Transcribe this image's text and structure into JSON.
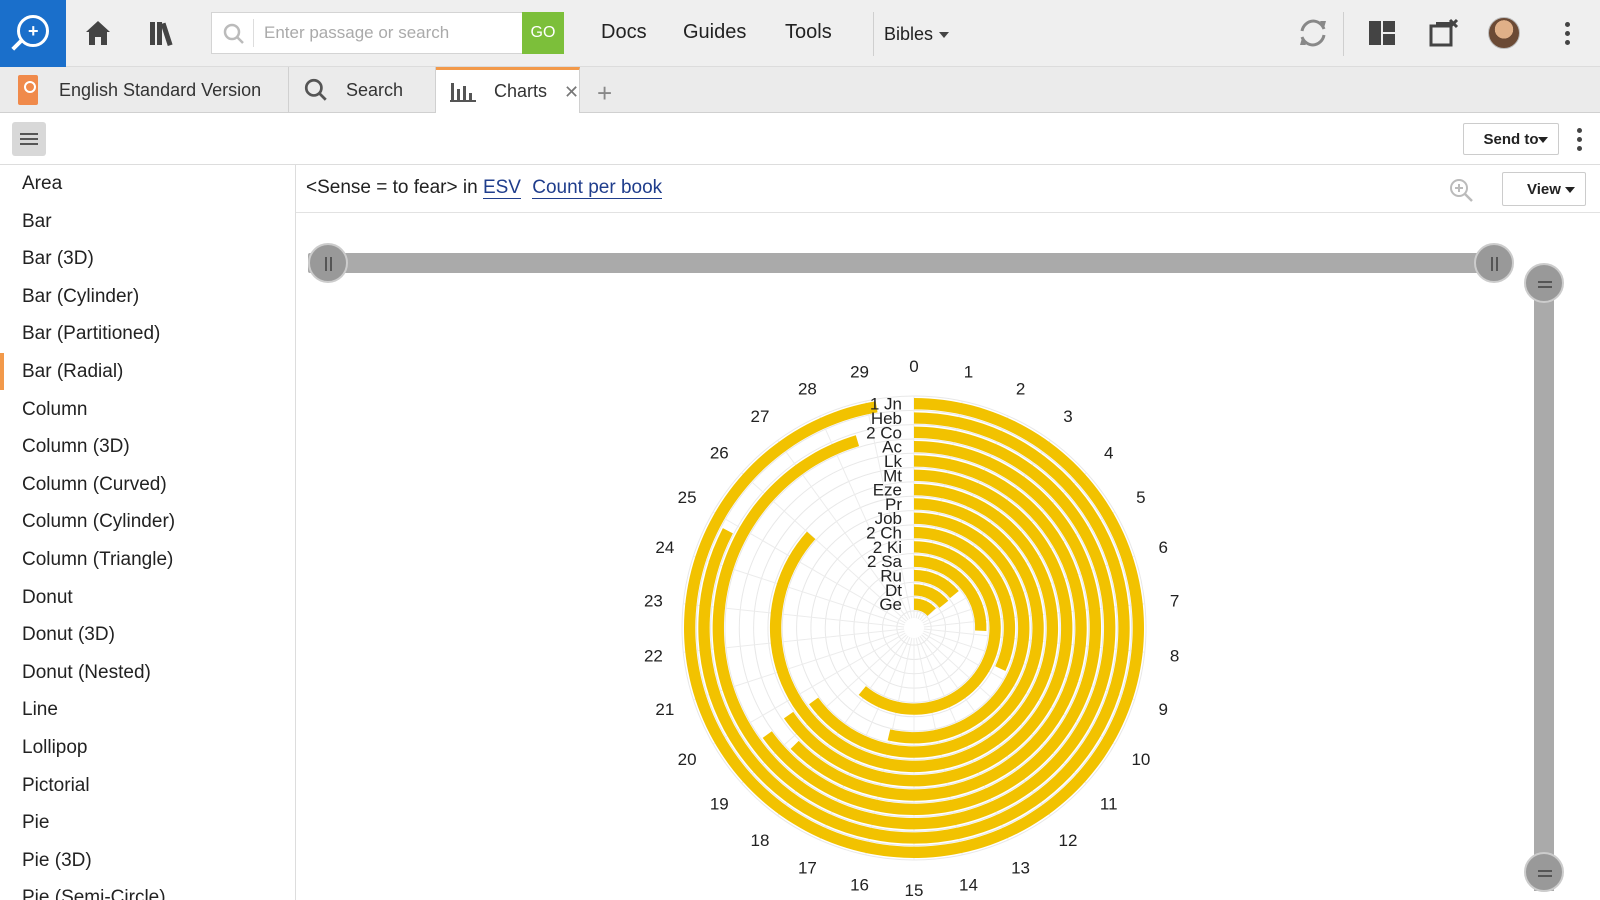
{
  "toolbar": {
    "search_placeholder": "Enter passage or search",
    "go_label": "GO",
    "nav": [
      "Docs",
      "Guides",
      "Tools"
    ],
    "bibles_label": "Bibles"
  },
  "tabs": [
    {
      "label": "English Standard Version"
    },
    {
      "label": "Search"
    },
    {
      "label": "Charts"
    }
  ],
  "panel": {
    "send_to_label": "Send to",
    "view_label": "View"
  },
  "sidebar": {
    "items": [
      "Area",
      "Bar",
      "Bar (3D)",
      "Bar (Cylinder)",
      "Bar (Partitioned)",
      "Bar (Radial)",
      "Column",
      "Column (3D)",
      "Column (Curved)",
      "Column (Cylinder)",
      "Column (Triangle)",
      "Donut",
      "Donut (3D)",
      "Donut (Nested)",
      "Line",
      "Lollipop",
      "Pictorial",
      "Pie",
      "Pie (3D)",
      "Pie (Semi-Circle)"
    ],
    "selected_index": 5
  },
  "query": {
    "text": "<Sense = to fear> in ",
    "resource": "ESV",
    "measure": "Count per book"
  },
  "chart_data": {
    "type": "bar",
    "orientation": "radial",
    "categories": [
      "1 Jn",
      "Heb",
      "2 Co",
      "Ac",
      "Lk",
      "Mt",
      "Eze",
      "Pr",
      "Job",
      "2 Ch",
      "2 Ki",
      "2 Sa",
      "Ru",
      "Dt",
      "Ge"
    ],
    "values": [
      0,
      4.5,
      3.7,
      0,
      5.7,
      4.1,
      0,
      0.7,
      9.9,
      2.8,
      0,
      14.6,
      0,
      0,
      0
    ],
    "values_extra": [
      29.2,
      24.8,
      28.6,
      19.5,
      18.8,
      19.6,
      26.0,
      19.5,
      16.1,
      9.6,
      18.3,
      7.7,
      4.2,
      4.3,
      4.0
    ],
    "axis_ticks": [
      0,
      1,
      2,
      3,
      4,
      5,
      6,
      7,
      8,
      9,
      10,
      11,
      12,
      13,
      14,
      15,
      16,
      17,
      18,
      19,
      20,
      21,
      22,
      23,
      24,
      25,
      26,
      27,
      28,
      29
    ],
    "axis_max": 30,
    "color": "#f2c200",
    "grid": true
  }
}
